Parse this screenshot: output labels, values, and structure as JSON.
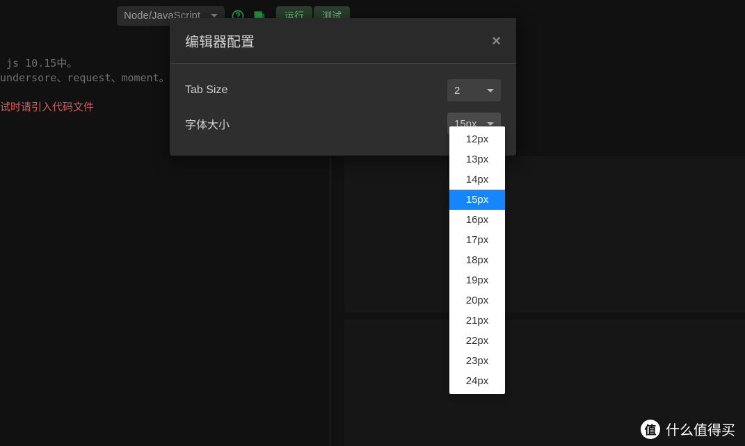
{
  "toolbar": {
    "language": "Node/JavaScript",
    "run_label": "运行",
    "test_label": "测试"
  },
  "editor": {
    "line1": " js 10.15中。",
    "line2": "undersore、request、moment。",
    "line3": "试时请引入代码文件"
  },
  "modal": {
    "title": "编辑器配置",
    "tab_size_label": "Tab Size",
    "tab_size_value": "2",
    "font_size_label": "字体大小",
    "font_size_value": "15px"
  },
  "font_size_options": [
    "12px",
    "13px",
    "14px",
    "15px",
    "16px",
    "17px",
    "18px",
    "19px",
    "20px",
    "21px",
    "22px",
    "23px",
    "24px"
  ],
  "font_size_selected": "15px",
  "watermark": {
    "icon_text": "值",
    "text": "什么值得买"
  }
}
